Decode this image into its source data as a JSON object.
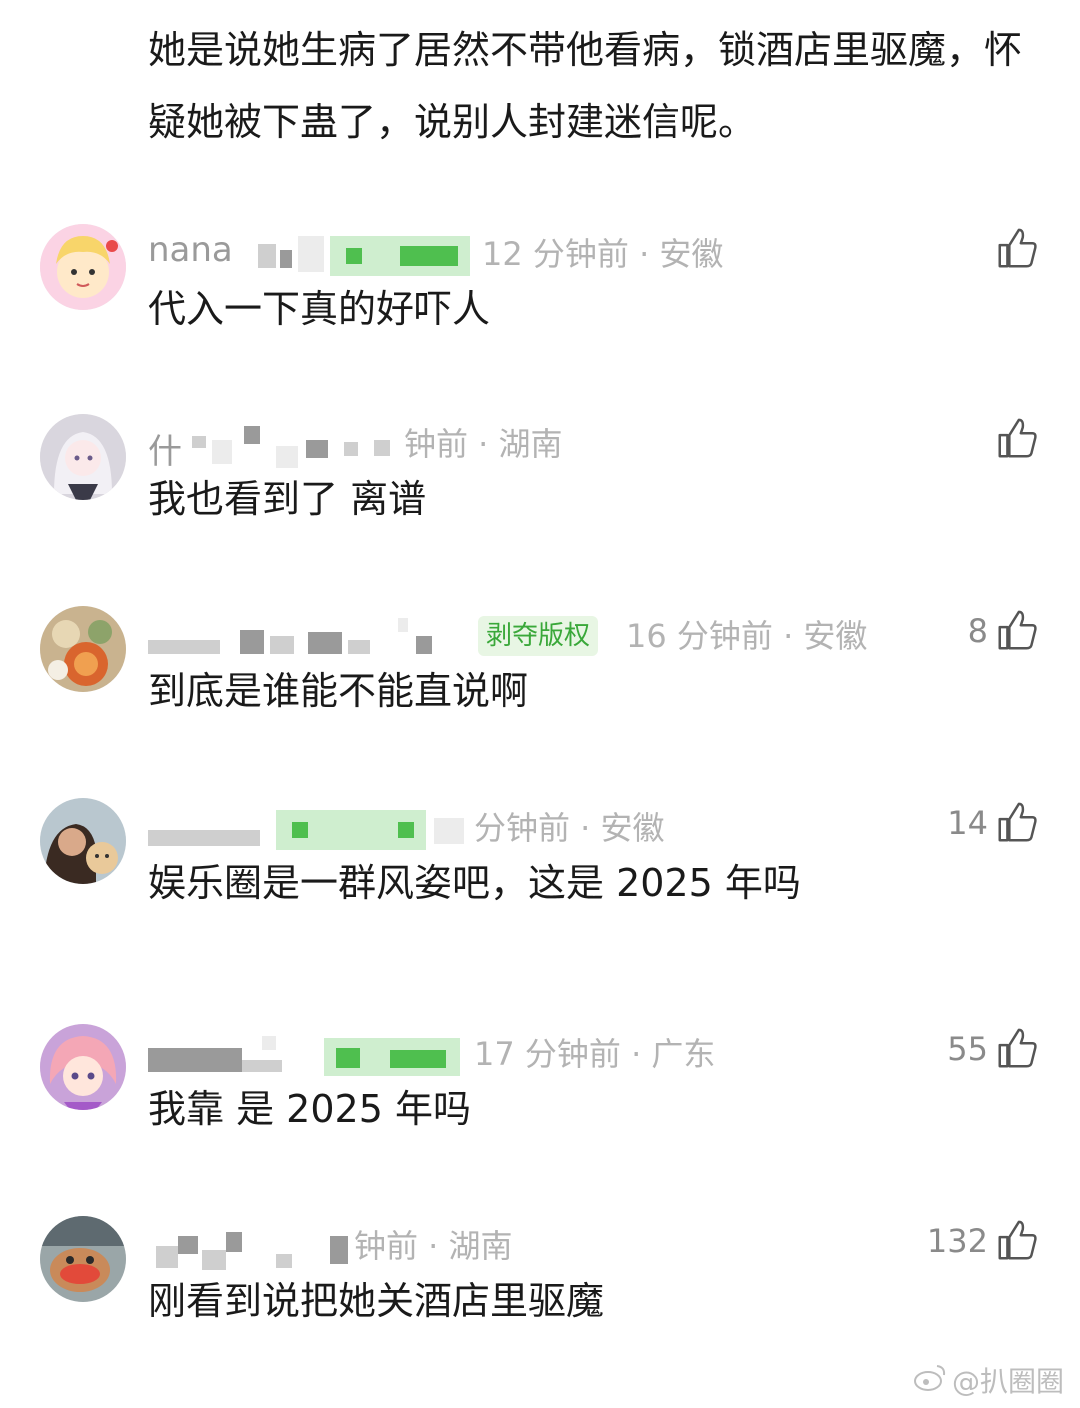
{
  "top_text": "她是说她生病了居然不带他看病，锁酒店里驱魔，怀疑她被下蛊了，说别人封建迷信呢。",
  "comments": [
    {
      "name_fragment": "nana",
      "time_location": "12 分钟前 · 安徽",
      "content": "代入一下真的好吓人",
      "likes": ""
    },
    {
      "name_fragment": "什",
      "time_location": "钟前 · 湖南",
      "content": "我也看到了 离谱",
      "likes": ""
    },
    {
      "name_fragment": "",
      "badge": "剥夺版权",
      "time_location": "16 分钟前 · 安徽",
      "content": "到底是谁能不能直说啊",
      "likes": "8"
    },
    {
      "name_fragment": "",
      "time_location": "分钟前 · 安徽",
      "content": "娱乐圈是一群风姿吧，这是 2025 年吗",
      "likes": "14"
    },
    {
      "name_fragment": "",
      "time_location": "17 分钟前 · 广东",
      "content": "我靠 是 2025 年吗",
      "likes": "55"
    },
    {
      "name_fragment": "",
      "time_location": "钟前 · 湖南",
      "content": "刚看到说把她关酒店里驱魔",
      "likes": "132"
    }
  ],
  "watermark": "@扒圈圈",
  "icons": {
    "like": "thumbs-up-icon",
    "watermark": "weibo-icon"
  },
  "colors": {
    "text": "#1a1a1a",
    "meta": "#b3b3b3",
    "badge_text": "#3aa83a",
    "badge_bg": "#e8f6e4"
  }
}
